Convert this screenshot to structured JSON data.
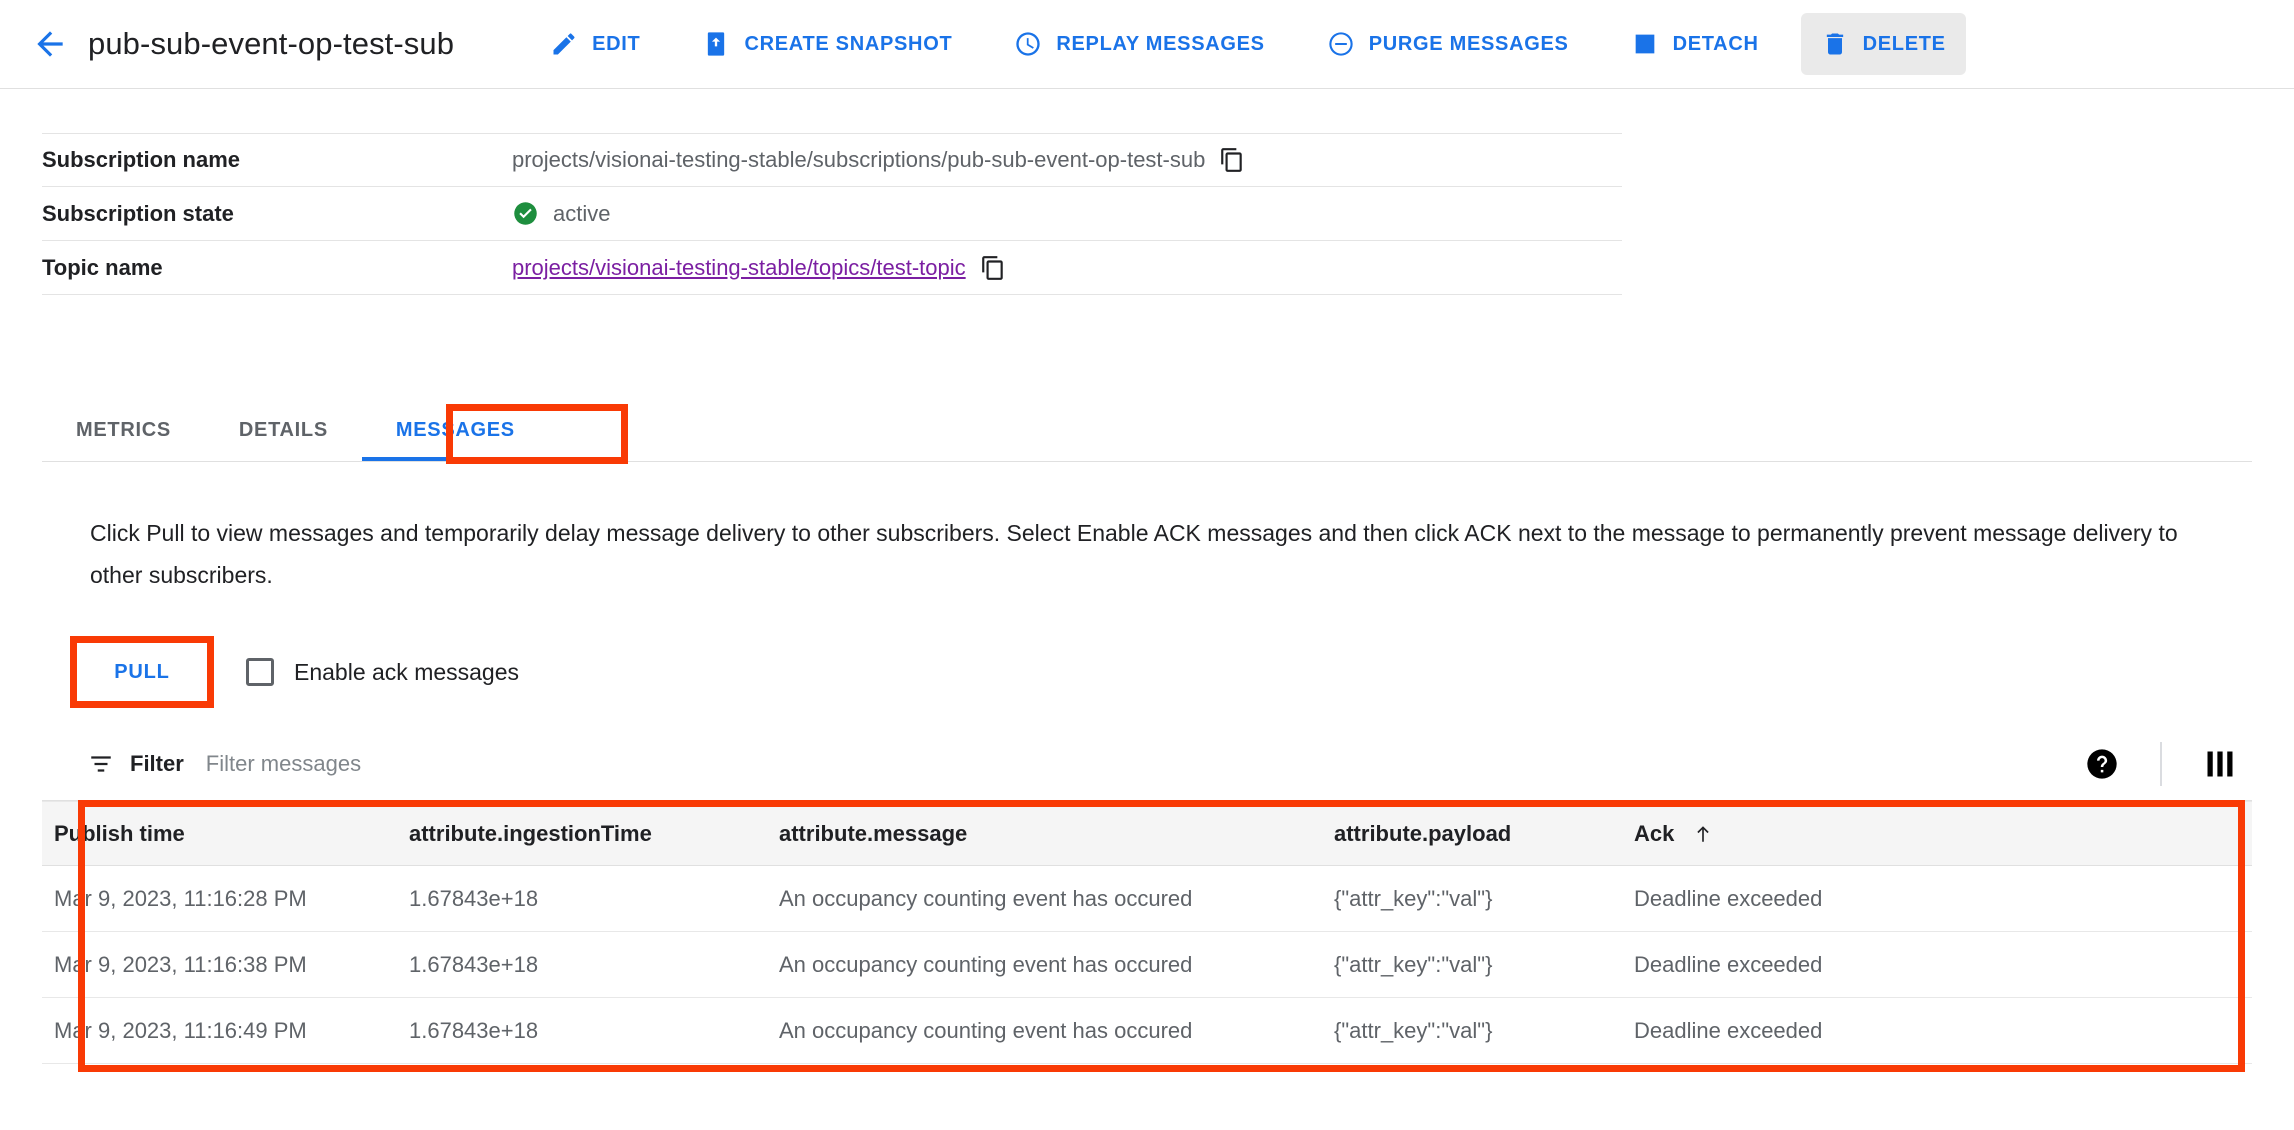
{
  "toolbar": {
    "back_icon": "arrow-back-icon",
    "title": "pub-sub-event-op-test-sub",
    "actions": [
      {
        "label": "EDIT",
        "icon": "pencil-icon",
        "active": false
      },
      {
        "label": "CREATE SNAPSHOT",
        "icon": "snapshot-icon",
        "active": false
      },
      {
        "label": "REPLAY MESSAGES",
        "icon": "clock-icon",
        "active": false
      },
      {
        "label": "PURGE MESSAGES",
        "icon": "minus-circle-icon",
        "active": false
      },
      {
        "label": "DETACH",
        "icon": "square-icon",
        "active": false
      },
      {
        "label": "DELETE",
        "icon": "trash-icon",
        "active": true
      }
    ]
  },
  "details": {
    "rows": [
      {
        "key": "Subscription name",
        "value": "projects/visionai-testing-stable/subscriptions/pub-sub-event-op-test-sub",
        "copy": true,
        "link": false,
        "status": false
      },
      {
        "key": "Subscription state",
        "value": "active",
        "copy": false,
        "link": false,
        "status": true
      },
      {
        "key": "Topic name",
        "value": "projects/visionai-testing-stable/topics/test-topic",
        "copy": true,
        "link": true,
        "status": false
      }
    ]
  },
  "tabs": [
    {
      "label": "METRICS",
      "selected": false
    },
    {
      "label": "DETAILS",
      "selected": false
    },
    {
      "label": "MESSAGES",
      "selected": true
    }
  ],
  "description": "Click Pull to view messages and temporarily delay message delivery to other subscribers. Select Enable ACK messages and then click ACK next to the message to permanently prevent message delivery to other subscribers.",
  "controls": {
    "pull_label": "PULL",
    "ack_checkbox_label": "Enable ack messages",
    "ack_checkbox_checked": false
  },
  "filter": {
    "icon": "filter-icon",
    "label": "Filter",
    "placeholder": "Filter messages",
    "value": "",
    "help_icon": "help-icon",
    "columns_icon": "column-display-icon"
  },
  "messages_table": {
    "columns": [
      {
        "label": "Publish time",
        "sorted": false
      },
      {
        "label": "attribute.ingestionTime",
        "sorted": false
      },
      {
        "label": "attribute.message",
        "sorted": false
      },
      {
        "label": "attribute.payload",
        "sorted": false
      },
      {
        "label": "Ack",
        "sorted": true,
        "sort_dir": "asc"
      }
    ],
    "rows": [
      [
        "Mar 9, 2023, 11:16:28 PM",
        "1.67843e+18",
        "An occupancy counting event has occured",
        "{\"attr_key\":\"val\"}",
        "Deadline exceeded"
      ],
      [
        "Mar 9, 2023, 11:16:38 PM",
        "1.67843e+18",
        "An occupancy counting event has occured",
        "{\"attr_key\":\"val\"}",
        "Deadline exceeded"
      ],
      [
        "Mar 9, 2023, 11:16:49 PM",
        "1.67843e+18",
        "An occupancy counting event has occured",
        "{\"attr_key\":\"val\"}",
        "Deadline exceeded"
      ]
    ]
  },
  "colors": {
    "accent_blue": "#1a73e8",
    "link_purple": "#7b1fa2",
    "status_green": "#1e8e3e",
    "annotation_red": "#f93a05",
    "header_gray": "#f5f5f5"
  },
  "annotations": [
    {
      "name": "messages-tab-highlight"
    },
    {
      "name": "pull-button-highlight"
    },
    {
      "name": "messages-table-highlight"
    }
  ]
}
